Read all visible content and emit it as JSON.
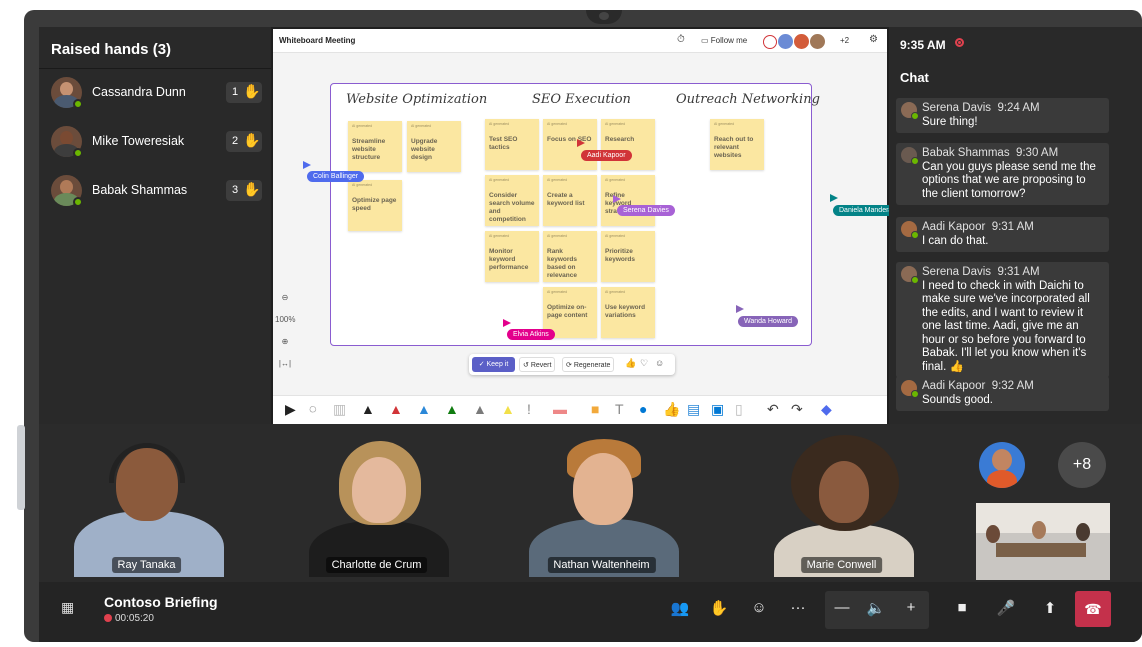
{
  "raised_hands": {
    "title": "Raised hands (3)",
    "people": [
      {
        "name": "Cassandra Dunn",
        "order": "1"
      },
      {
        "name": "Mike Toweresiak",
        "order": "2"
      },
      {
        "name": "Babak Shammas",
        "order": "3"
      }
    ],
    "hand_glyph": "✋"
  },
  "whiteboard": {
    "title": "Whiteboard Meeting",
    "follow_label": "Follow me",
    "extra_count": "+2",
    "columns": [
      "Website Optimization",
      "SEO Execution",
      "Outreach Networking"
    ],
    "notes": [
      "Streamline website structure",
      "Upgrade website design",
      "Optimize page speed",
      "Test SEO tactics",
      "Focus on SEO",
      "Research",
      "Consider search volume and competition",
      "Create a keyword list",
      "Refine keyword strategy",
      "Monitor keyword performance",
      "Rank keywords based on relevance",
      "Prioritize keywords",
      "Optimize on-page content",
      "Use keyword variations",
      "Reach out to relevant websites"
    ],
    "cursors": [
      "Colin Ballinger",
      "Aadi Kapoor",
      "Serena Davies",
      "Daniela Mandera",
      "Elvia Atkins",
      "Wanda Howard"
    ],
    "zoom": "100%",
    "actions": {
      "keep": "✓ Keep it",
      "revert": "Revert",
      "regenerate": "Regenerate"
    }
  },
  "chat": {
    "time": "9:35 AM",
    "title": "Chat",
    "messages": [
      {
        "author": "Serena Davis",
        "time": "9:24 AM",
        "text": "Sure thing!"
      },
      {
        "author": "Babak Shammas",
        "time": "9:30 AM",
        "text": "Can you guys please send me the options that we are proposing to the client tomorrow?"
      },
      {
        "author": "Aadi Kapoor",
        "time": "9:31 AM",
        "text": "I can do that."
      },
      {
        "author": "Serena Davis",
        "time": "9:31 AM",
        "text": "I need to check in with Daichi to make sure we've incorporated all the edits, and I want to review it one last time. Aadi, give me an hour or so before you forward to Babak. I'll let you know when it's final. 👍"
      },
      {
        "author": "Aadi Kapoor",
        "time": "9:32 AM",
        "text": "Sounds good."
      }
    ]
  },
  "participants": [
    "Ray Tanaka",
    "Charlotte de Crum",
    "Nathan Waltenheim",
    "Marie Conwell"
  ],
  "more_participants": "+8",
  "meeting": {
    "title": "Contoso Briefing",
    "duration": "00:05:20"
  },
  "controls": {
    "people": "👥",
    "raise": "✋",
    "react": "☺",
    "more": "···",
    "minus": "—",
    "speaker": "🔈",
    "plus": "+",
    "camera": "■",
    "mic": "🎤",
    "share": "⬆",
    "leave": "☎"
  }
}
